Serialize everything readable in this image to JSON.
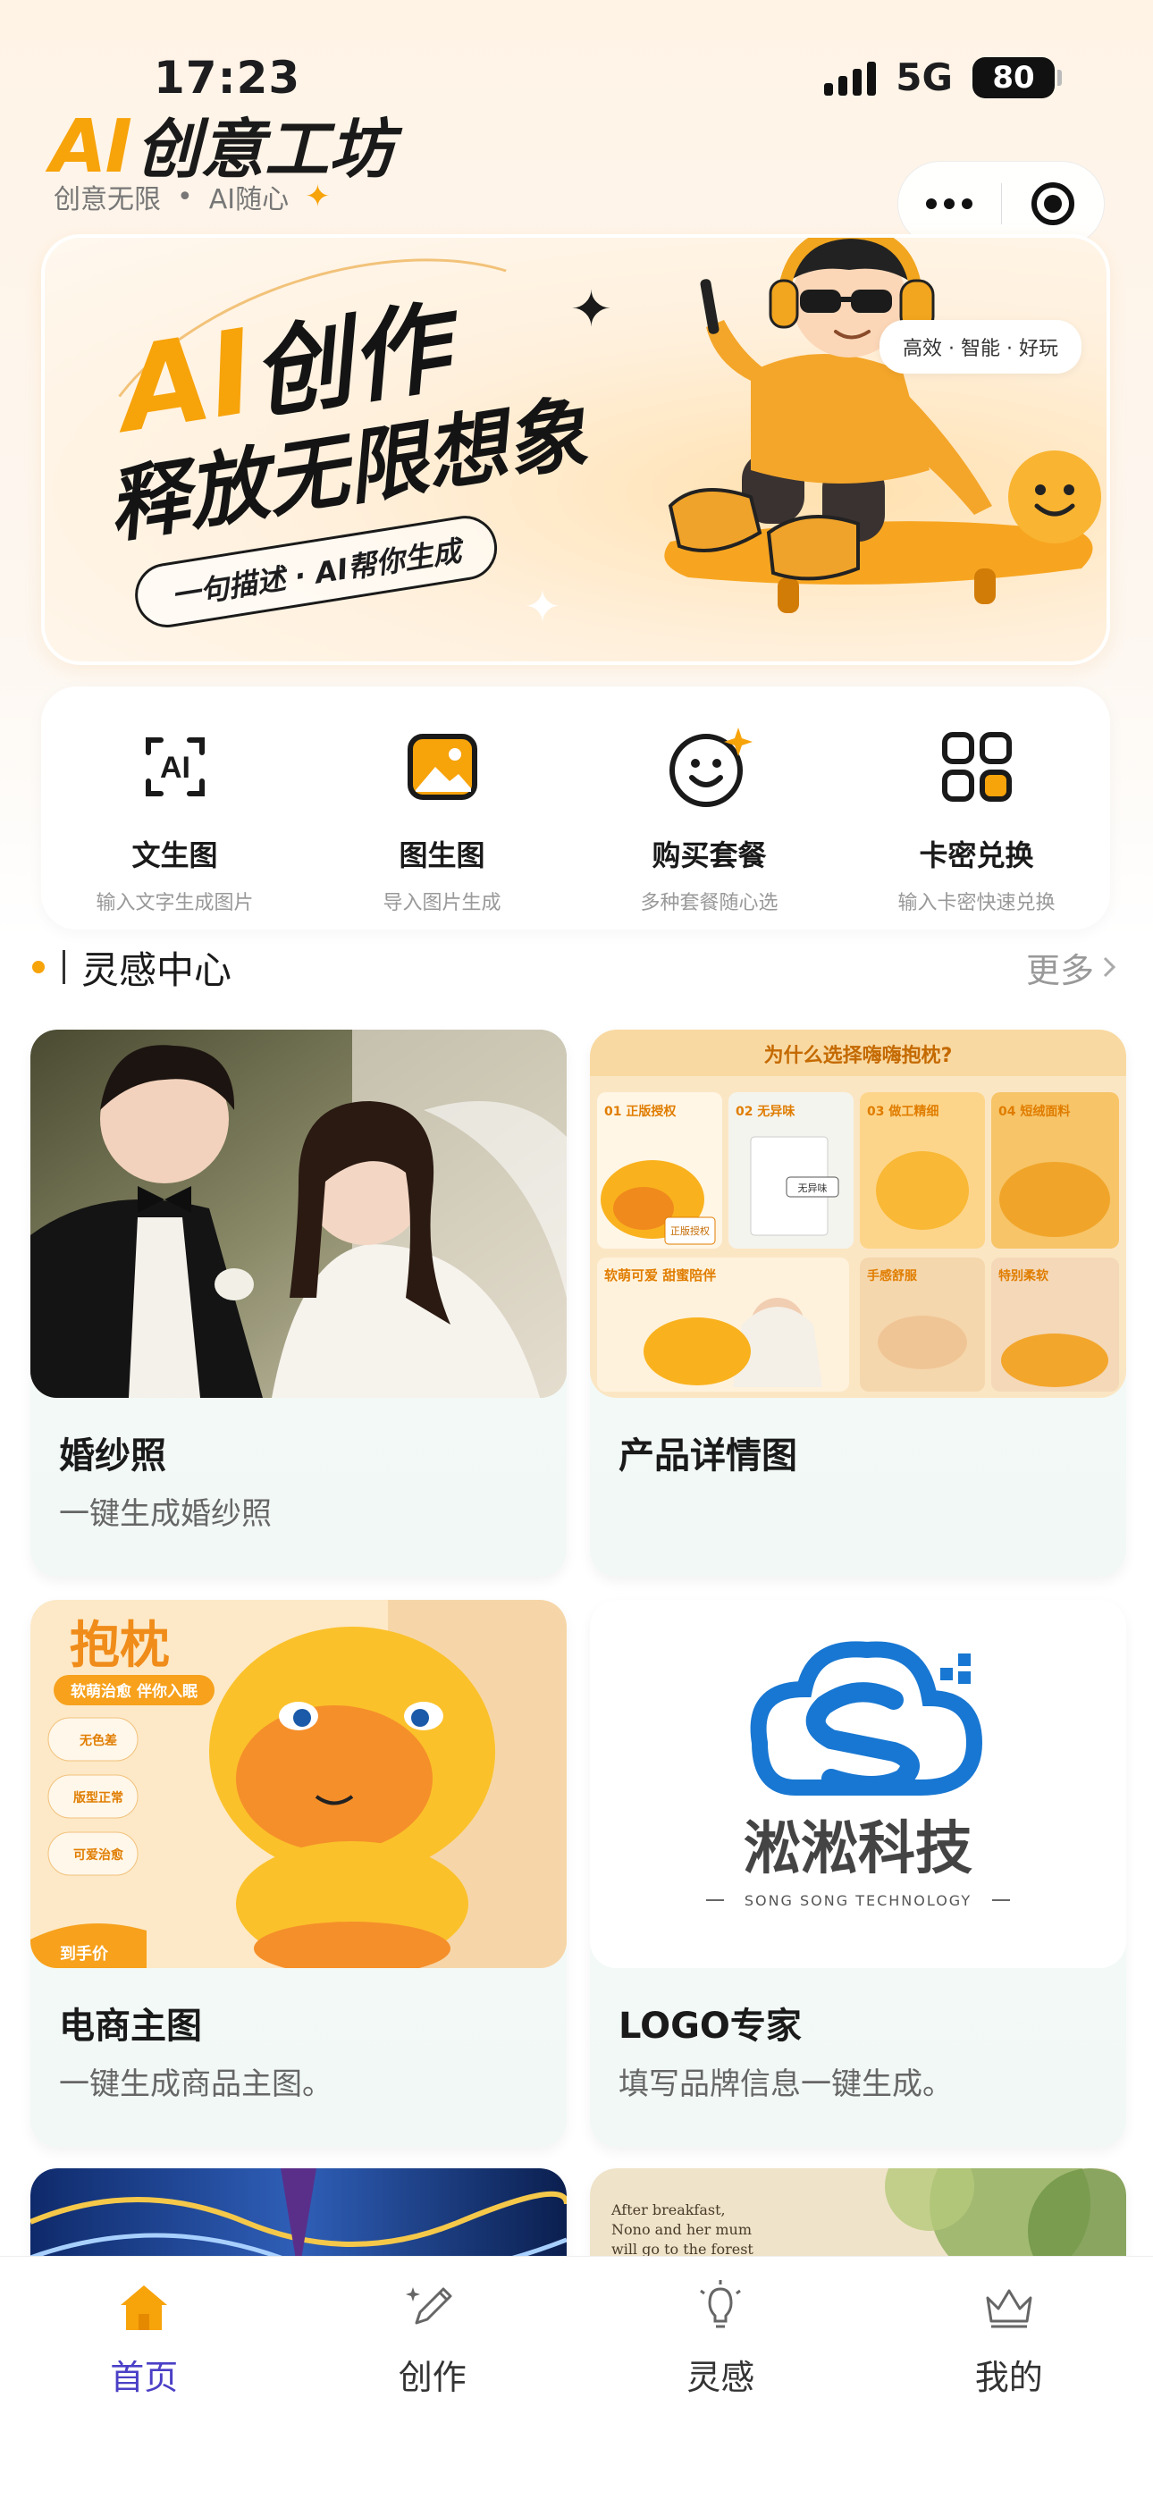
{
  "status_bar": {
    "time": "17:23",
    "network": "5G",
    "battery": "80"
  },
  "header": {
    "logo_ai": "AI",
    "logo_name": "创意工坊",
    "tagline_left": "创意无限",
    "tagline_dot": "•",
    "tagline_right": "AI随心",
    "tagline_star": "✦"
  },
  "banner": {
    "title_ai": "AI",
    "title_rest": "创作",
    "subtitle": "释放无限想象",
    "pill": "一句描述 · AI帮你生成",
    "badge": "高效 · 智能 · 好玩"
  },
  "actions": [
    {
      "title": "文生图",
      "subtitle": "输入文字生成图片",
      "icon": "ai-text-icon"
    },
    {
      "title": "图生图",
      "subtitle": "导入图片生成",
      "icon": "image-icon"
    },
    {
      "title": "购买套餐",
      "subtitle": "多种套餐随心选",
      "icon": "smile-sparkle-icon"
    },
    {
      "title": "卡密兑换",
      "subtitle": "输入卡密快速兑换",
      "icon": "grid-icon"
    }
  ],
  "section": {
    "title": "灵感中心",
    "more": "更多"
  },
  "cards": [
    {
      "title": "婚纱照",
      "desc": "一键生成婚纱照"
    },
    {
      "title": "产品详情图",
      "desc": "",
      "image_text": {
        "headline": "为什么选择嗨嗨抱枕?",
        "cells": [
          "01 正版授权",
          "02 无异味",
          "03 做工精细",
          "04 短绒面料",
          "软萌可爱 甜蜜陪伴",
          "手感舒服",
          "特别柔软"
        ],
        "stamp": "无异味",
        "tag": "正版授权"
      }
    },
    {
      "title": "电商主图",
      "desc": "一键生成商品主图。",
      "image_text": {
        "headline": "抱枕",
        "sub": "软萌治愈 伴你入眠",
        "features": [
          "无色差",
          "版型正常",
          "可爱治愈"
        ],
        "bottom": "到手价"
      }
    },
    {
      "title": "LOGO专家",
      "desc": "填写品牌信息一键生成。",
      "image_text": {
        "brand_cn": "淞淞科技",
        "brand_en": "SONG SONG TECHNOLOGY"
      }
    },
    {
      "title": "",
      "desc": ""
    },
    {
      "title": "",
      "desc": "",
      "image_text": {
        "line1": "After breakfast,",
        "line2": "Nono and her mum",
        "line3": "will go to the forest"
      }
    }
  ],
  "tabbar": [
    {
      "label": "首页",
      "icon": "home-icon",
      "active": true
    },
    {
      "label": "创作",
      "icon": "pencil-icon",
      "active": false
    },
    {
      "label": "灵感",
      "icon": "lightbulb-icon",
      "active": false
    },
    {
      "label": "我的",
      "icon": "crown-icon",
      "active": false
    }
  ],
  "colors": {
    "accent": "#f7a30a",
    "tab_active": "#4a3fc6"
  }
}
